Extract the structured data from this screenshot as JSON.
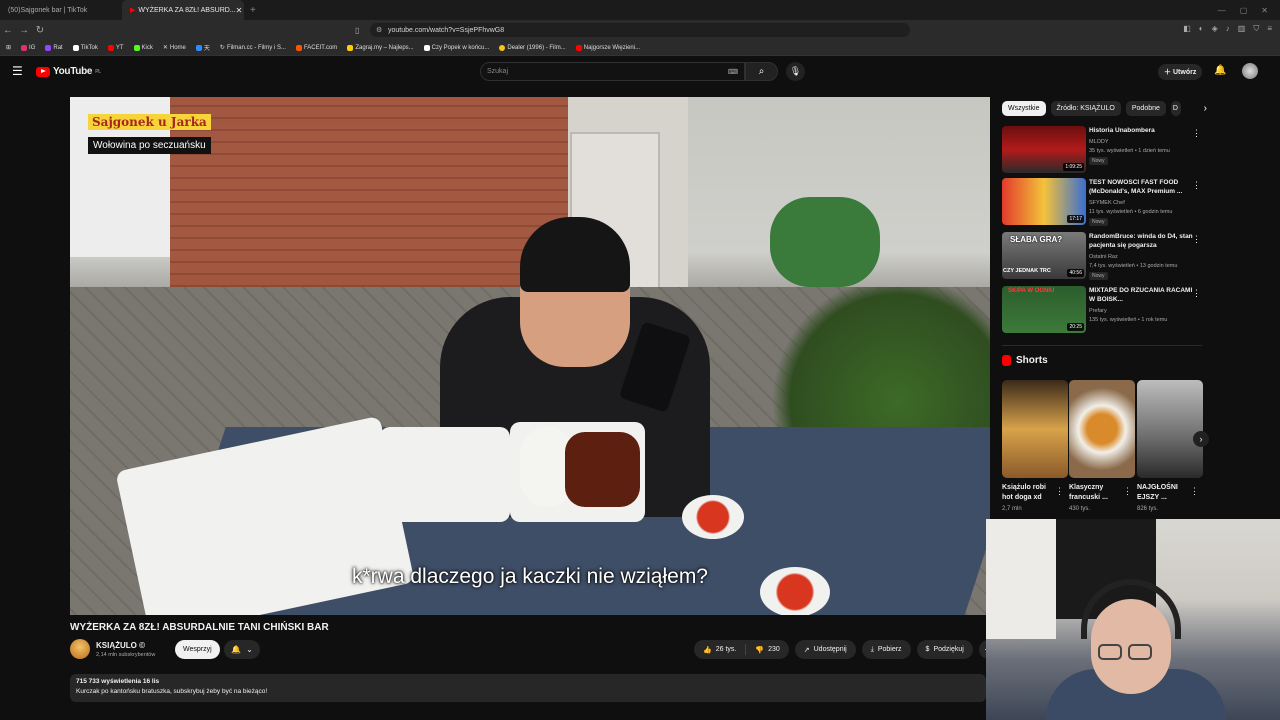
{
  "browser": {
    "tabs": [
      {
        "label": "(50)Sajgonek bar | TikTok"
      },
      {
        "label": "WYŻERKA ZA 8ZŁ! ABSURD..."
      }
    ],
    "url": "youtube.com/watch?v=SsjePFhvwG8",
    "bookmarks": [
      {
        "label": "IG",
        "color": "#e1306c"
      },
      {
        "label": "Rat",
        "color": "#9146ff"
      },
      {
        "label": "TikTok",
        "color": "#ffffff"
      },
      {
        "label": "YT",
        "color": "#ff0000"
      },
      {
        "label": "Kick",
        "color": "#53fc18"
      },
      {
        "label": "Home",
        "color": "#ffffff"
      },
      {
        "label": "",
        "color": "#2d8cff"
      },
      {
        "label": "Filman.cc - Filmy i S...",
        "color": "#888888"
      },
      {
        "label": "FACEIT.com",
        "color": "#ff5500"
      },
      {
        "label": "Zagraj.my – Najleps...",
        "color": "#ffcc00"
      },
      {
        "label": "Czy Popek w końcu...",
        "color": "#ffffff"
      },
      {
        "label": "Dealer (1996) - Film...",
        "color": "#f5c518"
      },
      {
        "label": "Najgorsze Więzieni...",
        "color": "#ff0000"
      }
    ]
  },
  "youtube": {
    "logo": "YouTube",
    "region": "PL",
    "search_placeholder": "Szukaj",
    "create_label": "Utwórz"
  },
  "video": {
    "overlay_title": "Sajgonek u Jarka",
    "overlay_dish": "Wołowina po seczuańsku",
    "subtitle": "k*rwa dlaczego ja kaczki nie wziąłem?",
    "title": "WYŻERKA ZA 8ZŁ! ABSURDALNIE TANI CHIŃSKI BAR",
    "channel": "KSIĄŻULO ©",
    "subscribers": "2,14 mln subskrybentów",
    "support_label": "Wesprzyj",
    "likes": "26 tys.",
    "dislikes": "230",
    "share_label": "Udostępnij",
    "download_label": "Pobierz",
    "thanks_label": "Podziękuj",
    "views_line": "715 733 wyświetlenia  16 lis",
    "description": "Kurczak po kantońsku bratuszka, subskrybuj żeby być na bieżąco!"
  },
  "sidebar": {
    "chips": [
      "Wszystkie",
      "Źródło: KSIĄŻULO",
      "Podobne",
      "D"
    ],
    "recommendations": [
      {
        "title": "Historia Unabombera",
        "channel": "MLODY",
        "meta": "35 tys. wyświetleń • 1 dzień temu",
        "badge": "Nowy",
        "duration": "1:09:25"
      },
      {
        "title": "TEST NOWOŚCI FAST FOOD (McDonald's, MAX Premium ...",
        "channel": "SFYMEK Chef",
        "meta": "11 tys. wyświetleń • 6 godzin temu",
        "badge": "Nowy",
        "duration": "17:17"
      },
      {
        "title": "RandomBruce: winda do D4, stan pacjenta się pogarsza",
        "channel": "Ostatni Raz",
        "meta": "7,4 tys. wyświetleń • 13 godzin temu",
        "badge": "Nowy",
        "duration": "40:56",
        "thumb_text": "SŁABA GRA?",
        "thumb_text2": "CZY JEDNAK TRC"
      },
      {
        "title": "MIXTAPE DO RZUCANIA RACAMI W BOISK...",
        "channel": "Prefary",
        "meta": "135 tys. wyświetleń • 1 rok temu",
        "badge": "",
        "duration": "20:25",
        "thumb_text": "SKIPA W OGNIU"
      }
    ],
    "shorts_label": "Shorts",
    "shorts": [
      {
        "title": "Książulo robi hot doga xd",
        "views": "2,7 mln"
      },
      {
        "title": "Klasyczny francuski ...",
        "views": "430 tys."
      },
      {
        "title": "NAJGŁOŚNI EJSZY ...",
        "views": "826 tys."
      }
    ]
  }
}
